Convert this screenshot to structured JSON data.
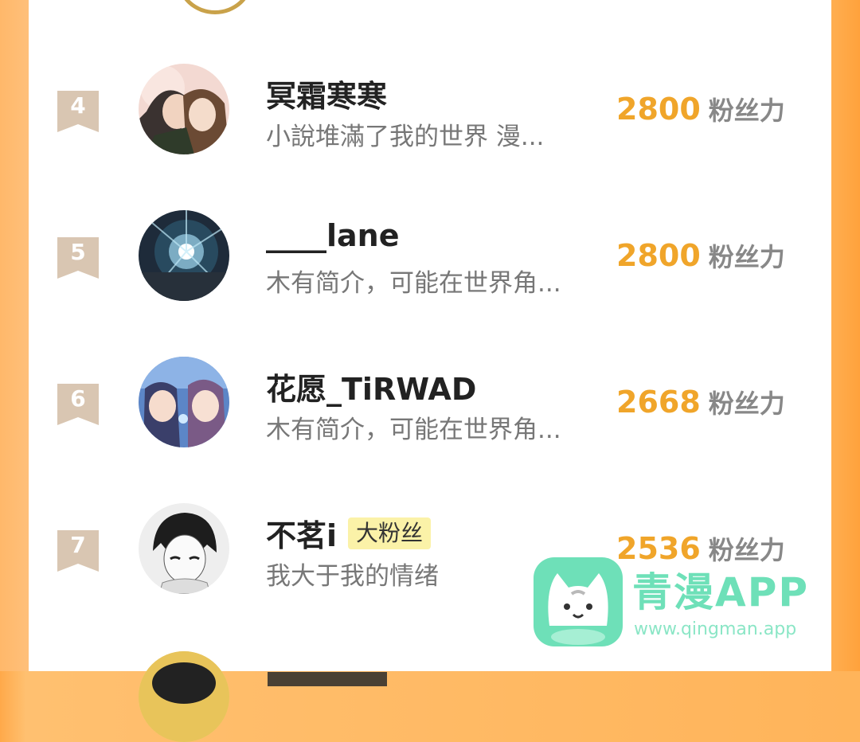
{
  "rows": [
    {
      "rank": "4",
      "name": "冥霜寒寒",
      "tag": "",
      "bio": "小說堆滿了我的世界 漫...",
      "score": "2800",
      "score_label": "粉丝力",
      "avatar_icon": "anime-couple-avatar"
    },
    {
      "rank": "5",
      "name": "____lane",
      "tag": "",
      "bio": "木有简介，可能在世界角...",
      "score": "2800",
      "score_label": "粉丝力",
      "avatar_icon": "light-burst-avatar"
    },
    {
      "rank": "6",
      "name": "花愿_TiRWAD",
      "tag": "",
      "bio": "木有简介，可能在世界角...",
      "score": "2668",
      "score_label": "粉丝力",
      "avatar_icon": "anime-pair-avatar"
    },
    {
      "rank": "7",
      "name": "不茗i",
      "tag": "大粉丝",
      "bio": "我大于我的情绪",
      "score": "2536",
      "score_label": "粉丝力",
      "avatar_icon": "manga-boy-avatar"
    }
  ],
  "watermark": {
    "title": "青漫APP",
    "url": "www.qingman.app",
    "icon": "cat-logo-icon"
  },
  "colors": {
    "accent": "#f0a52a",
    "badge": "#d9c6b2",
    "frame": "#ffa94a",
    "watermark": "#6ee0b8"
  }
}
